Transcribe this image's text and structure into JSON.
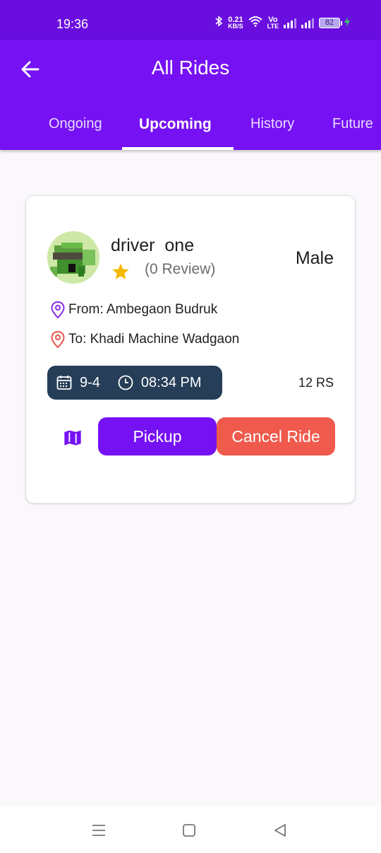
{
  "status_bar": {
    "time": "19:36",
    "net_speed_value": "0.21",
    "net_speed_unit": "KB/S",
    "volte_top": "Vo",
    "volte_bottom": "LTE",
    "battery": "82",
    "icons": [
      "bluetooth-icon",
      "wifi-icon",
      "volte-icon",
      "signal-icon",
      "signal-icon",
      "battery-icon",
      "charging-icon"
    ]
  },
  "header": {
    "title": "All Rides",
    "back_icon": "arrow-left-icon",
    "tabs": [
      {
        "label": "Ongoing",
        "active": false
      },
      {
        "label": "Upcoming",
        "active": true
      },
      {
        "label": "History",
        "active": false
      },
      {
        "label": "Future",
        "active": false
      }
    ]
  },
  "ride": {
    "driver_name": "driver  one",
    "rating_icon": "star-icon",
    "reviews": "(0 Review)",
    "gender": "Male",
    "from": "From: Ambegaon Budruk",
    "to": "To: Khadi Machine Wadgaon",
    "date": "9-4",
    "time": "08:34 PM",
    "price": "12 RS",
    "pickup_label": "Pickup",
    "cancel_label": "Cancel Ride",
    "map_icon": "map-icon"
  },
  "colors": {
    "primary": "#7611f4",
    "status_bar": "#6a0ee0",
    "pill": "#263e58",
    "cancel": "#ef5a4c",
    "star": "#f5b800",
    "from_pin": "#8a2be2",
    "to_pin": "#e8564a"
  },
  "nav_bar": {
    "icons": [
      "menu-icon",
      "home-square-icon",
      "back-triangle-icon"
    ]
  }
}
